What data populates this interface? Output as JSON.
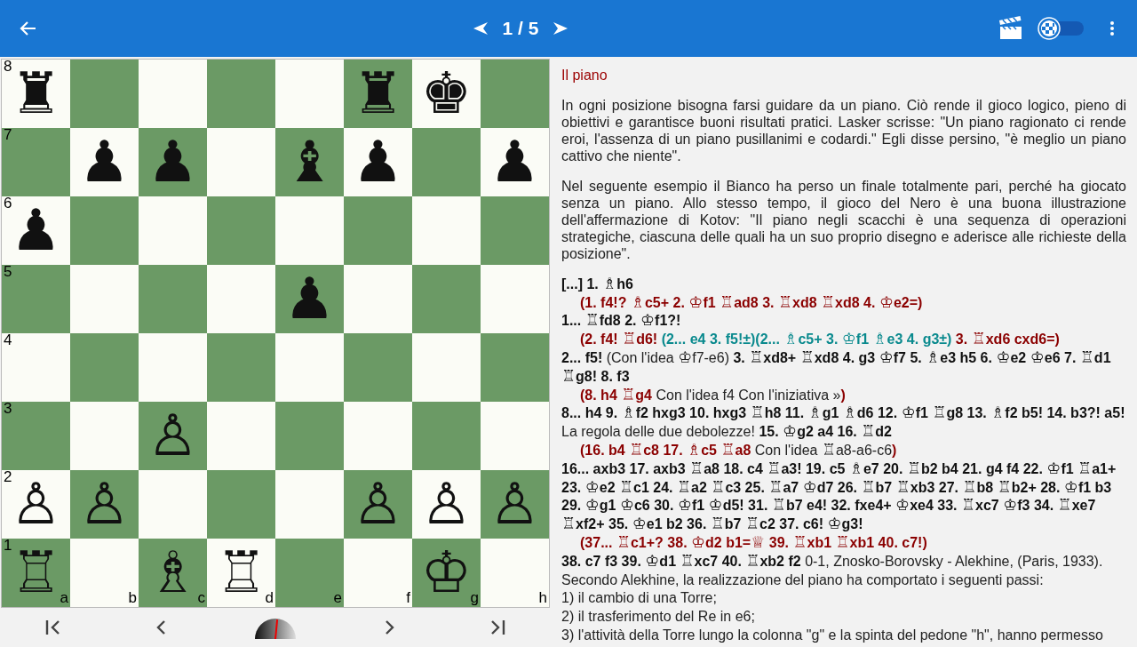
{
  "app_bar": {
    "page": "1 / 5",
    "board_toggle_on": false
  },
  "board": {
    "rank_labels": [
      "8",
      "7",
      "6",
      "5",
      "4",
      "3",
      "2",
      "1"
    ],
    "file_labels": [
      "a",
      "b",
      "c",
      "d",
      "e",
      "f",
      "g",
      "h"
    ],
    "ranks": [
      [
        {
          "kind": "piece",
          "glyph": "♜"
        },
        {
          "kind": "empty"
        },
        {
          "kind": "empty"
        },
        {
          "kind": "empty"
        },
        {
          "kind": "empty"
        },
        {
          "kind": "piece",
          "glyph": "♜"
        },
        {
          "kind": "piece",
          "glyph": "♚"
        },
        {
          "kind": "empty"
        }
      ],
      [
        {
          "kind": "empty"
        },
        {
          "kind": "piece",
          "glyph": "♟"
        },
        {
          "kind": "piece",
          "glyph": "♟"
        },
        {
          "kind": "empty"
        },
        {
          "kind": "piece",
          "glyph": "♝"
        },
        {
          "kind": "piece",
          "glyph": "♟"
        },
        {
          "kind": "empty"
        },
        {
          "kind": "piece",
          "glyph": "♟"
        }
      ],
      [
        {
          "kind": "piece",
          "glyph": "♟"
        },
        {
          "kind": "empty"
        },
        {
          "kind": "empty"
        },
        {
          "kind": "empty"
        },
        {
          "kind": "empty"
        },
        {
          "kind": "empty"
        },
        {
          "kind": "empty"
        },
        {
          "kind": "empty"
        }
      ],
      [
        {
          "kind": "empty"
        },
        {
          "kind": "empty"
        },
        {
          "kind": "empty"
        },
        {
          "kind": "empty"
        },
        {
          "kind": "piece",
          "glyph": "♟"
        },
        {
          "kind": "empty"
        },
        {
          "kind": "empty"
        },
        {
          "kind": "empty"
        }
      ],
      [
        {
          "kind": "empty"
        },
        {
          "kind": "empty"
        },
        {
          "kind": "empty"
        },
        {
          "kind": "empty"
        },
        {
          "kind": "empty"
        },
        {
          "kind": "empty"
        },
        {
          "kind": "empty"
        },
        {
          "kind": "empty"
        }
      ],
      [
        {
          "kind": "empty"
        },
        {
          "kind": "empty"
        },
        {
          "kind": "piece",
          "glyph": "♙"
        },
        {
          "kind": "empty"
        },
        {
          "kind": "empty"
        },
        {
          "kind": "empty"
        },
        {
          "kind": "empty"
        },
        {
          "kind": "empty"
        }
      ],
      [
        {
          "kind": "piece",
          "glyph": "♙"
        },
        {
          "kind": "piece",
          "glyph": "♙"
        },
        {
          "kind": "empty"
        },
        {
          "kind": "empty"
        },
        {
          "kind": "empty"
        },
        {
          "kind": "piece",
          "glyph": "♙"
        },
        {
          "kind": "piece",
          "glyph": "♙"
        },
        {
          "kind": "piece",
          "glyph": "♙"
        }
      ],
      [
        {
          "kind": "piece",
          "glyph": "♖"
        },
        {
          "kind": "empty"
        },
        {
          "kind": "piece",
          "glyph": "♗"
        },
        {
          "kind": "piece",
          "glyph": "♖"
        },
        {
          "kind": "empty"
        },
        {
          "kind": "empty"
        },
        {
          "kind": "piece",
          "glyph": "♔"
        },
        {
          "kind": "empty"
        }
      ]
    ]
  },
  "navigation": {
    "gauge": {
      "level": 0.53
    }
  },
  "lesson": {
    "title": "Il piano",
    "paragraphs": [
      "In ogni posizione bisogna farsi guidare da un piano. Ciò rende il gioco logico, pieno di obiettivi e garantisce buoni risultati pratici. Lasker scrisse: \"Un piano ragionato ci rende eroi, l'assenza di un piano pusillanimi e codardi.\" Egli disse persino, \"è meglio un piano cattivo che niente\".",
      "Nel seguente esempio il Bianco ha perso un finale totalmente pari, perché ha giocato senza un piano. Allo stesso tempo, il gioco del Nero è una buona illustrazione dell'affermazione di Kotov: \"Il piano negli scacchi è una sequenza di operazioni strategiche, ciascuna delle quali ha un suo proprio disegno e aderisce alle richieste della posizione\"."
    ],
    "notation": [
      {
        "indent": false,
        "segments": [
          {
            "kind": "move",
            "text": "[...] 1. ♗h6"
          }
        ]
      },
      {
        "indent": true,
        "segments": [
          {
            "kind": "variation",
            "text": "(1. f4!? ♗c5+ 2. ♔f1 ♖ad8 3. ♖xd8 ♖xd8 4. ♔e2=)"
          }
        ]
      },
      {
        "indent": false,
        "segments": [
          {
            "kind": "move",
            "text": "1... ♖fd8 2. ♔f1?!"
          }
        ]
      },
      {
        "indent": true,
        "segments": [
          {
            "kind": "variation",
            "text": "(2. f4! ♖d6! "
          },
          {
            "kind": "subvariation",
            "text": "(2... e4 3. f5!±)(2... ♗c5+ 3. ♔f1 ♗e3 4. g3±)"
          },
          {
            "kind": "variation",
            "text": " 3. ♖xd6 cxd6=)"
          }
        ]
      },
      {
        "indent": false,
        "segments": [
          {
            "kind": "move",
            "text": "2... f5! "
          },
          {
            "kind": "comment",
            "text": "(Con l'idea ♔f7-e6) "
          },
          {
            "kind": "move",
            "text": "3. ♖xd8+ ♖xd8 4. g3 ♔f7 5. ♗e3 h5 6. ♔e2 ♔e6 7. ♖d1 ♖g8! 8. f3"
          }
        ]
      },
      {
        "indent": true,
        "segments": [
          {
            "kind": "variation",
            "text": "(8. h4 ♖g4 "
          },
          {
            "kind": "comment",
            "text": "Con l'idea f4 Con l'iniziativa »"
          },
          {
            "kind": "variation",
            "text": ")"
          }
        ]
      },
      {
        "indent": false,
        "segments": [
          {
            "kind": "move",
            "text": "8... h4 9. ♗f2 hxg3 10. hxg3 ♖h8 11. ♗g1 ♗d6 12. ♔f1 ♖g8 13. ♗f2 b5! 14. b3?! a5! "
          },
          {
            "kind": "comment",
            "text": "La regola delle due debolezze! "
          },
          {
            "kind": "move",
            "text": "15. ♔g2 a4 16. ♖d2"
          }
        ]
      },
      {
        "indent": true,
        "segments": [
          {
            "kind": "variation",
            "text": "(16. b4 ♖c8 17. ♗c5 ♖a8 "
          },
          {
            "kind": "comment",
            "text": "Con l'idea ♖a8-a6-c6"
          },
          {
            "kind": "variation",
            "text": ")"
          }
        ]
      },
      {
        "indent": false,
        "segments": [
          {
            "kind": "move",
            "text": "16... axb3 17. axb3 ♖a8 18. c4 ♖a3! 19. c5 ♗e7 20. ♖b2 b4 21. g4 f4 22. ♔f1 ♖a1+ 23. ♔e2 ♖c1 24. ♖a2 ♖c3 25. ♖a7 ♔d7 26. ♖b7 ♖xb3 27. ♖b8 ♖b2+ 28. ♔f1 b3 29. ♔g1 ♔c6 30. ♔f1 ♔d5! 31. ♖b7 e4! 32. fxe4+ ♔xe4 33. ♖xc7 ♔f3 34. ♖xe7 ♖xf2+ 35. ♔e1 b2 36. ♖b7 ♖c2 37. c6! ♔g3!"
          }
        ]
      },
      {
        "indent": true,
        "segments": [
          {
            "kind": "variation",
            "text": "(37... ♖c1+? 38. ♔d2 b1=♕ 39. ♖xb1 ♖xb1 40. c7!)"
          }
        ]
      },
      {
        "indent": false,
        "segments": [
          {
            "kind": "move",
            "text": "38. c7 f3 39. ♔d1 ♖xc7 40. ♖xb2 f2"
          },
          {
            "kind": "comment",
            "text": " 0-1, Znosko-Borovsky - Alekhine, (Paris, 1933)."
          }
        ]
      },
      {
        "indent": false,
        "segments": [
          {
            "kind": "comment",
            "text": "Secondo Alekhine, la realizzazione del piano ha comportato i seguenti passi:"
          }
        ]
      },
      {
        "indent": false,
        "segments": [
          {
            "kind": "comment",
            "text": "1) il cambio di una Torre;"
          }
        ]
      },
      {
        "indent": false,
        "segments": [
          {
            "kind": "comment",
            "text": "2) il trasferimento del Re in e6;"
          }
        ]
      },
      {
        "indent": false,
        "segments": [
          {
            "kind": "comment",
            "text": "3) l'attività della Torre lungo la colonna \"g\" e la spinta del pedone \"h\", hanno permesso"
          }
        ]
      }
    ]
  }
}
